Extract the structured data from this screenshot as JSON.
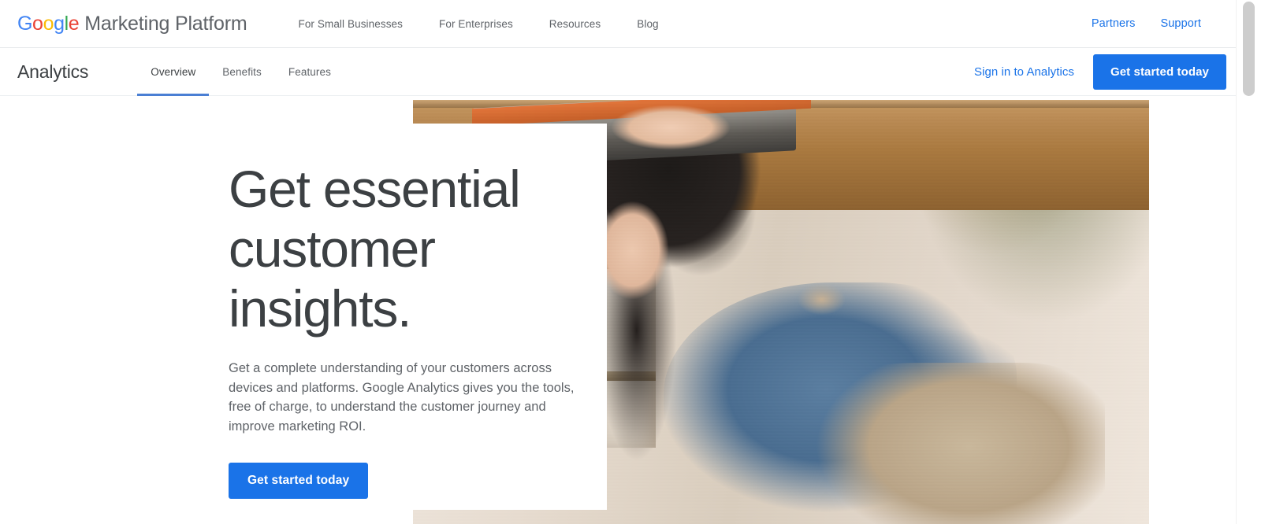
{
  "brand": {
    "google_letters": [
      {
        "char": "G",
        "color": "#4285f4"
      },
      {
        "char": "o",
        "color": "#ea4335"
      },
      {
        "char": "o",
        "color": "#fbbc05"
      },
      {
        "char": "g",
        "color": "#4285f4"
      },
      {
        "char": "l",
        "color": "#34a853"
      },
      {
        "char": "e",
        "color": "#ea4335"
      }
    ],
    "google_word": "Google",
    "suffix": "Marketing Platform"
  },
  "global_nav": {
    "items": [
      {
        "label": "For Small Businesses"
      },
      {
        "label": "For Enterprises"
      },
      {
        "label": "Resources"
      },
      {
        "label": "Blog"
      }
    ],
    "right_links": [
      {
        "label": "Partners"
      },
      {
        "label": "Support"
      }
    ]
  },
  "product_bar": {
    "title": "Analytics",
    "tabs": [
      {
        "label": "Overview",
        "active": true
      },
      {
        "label": "Benefits",
        "active": false
      },
      {
        "label": "Features",
        "active": false
      }
    ],
    "signin_label": "Sign in to Analytics",
    "cta_label": "Get started today"
  },
  "hero": {
    "title": "Get essential customer insights.",
    "body": "Get a complete understanding of your customers across devices and platforms. Google Analytics gives you the tools, free of charge, to understand the customer journey and improve marketing ROI.",
    "cta_label": "Get started today",
    "image_alt": "Woman in denim shirt and beige apron leaning over a laptop at a wooden counter in a shop"
  },
  "colors": {
    "accent_blue": "#1a73e8",
    "link_blue": "#1a73e8",
    "tab_underline": "#4a7fd4",
    "text_primary": "#3c4043",
    "text_secondary": "#5f6368",
    "divider": "#e8eaed",
    "page_background": "#ffffff"
  }
}
